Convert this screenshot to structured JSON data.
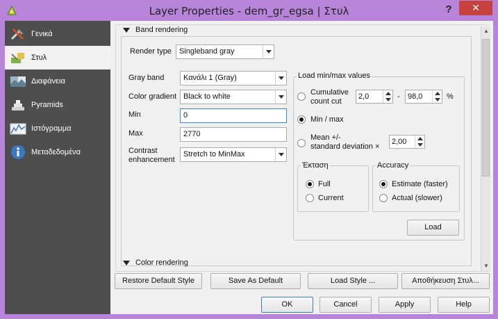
{
  "window": {
    "title": "Layer Properties - dem_gr_egsa | Στυλ",
    "help": "?",
    "close": "✕"
  },
  "sidebar": {
    "items": [
      {
        "label": "Γενικά",
        "icon": "tools-icon"
      },
      {
        "label": "Στυλ",
        "icon": "style-icon"
      },
      {
        "label": "Διαφάνεια",
        "icon": "transparency-icon"
      },
      {
        "label": "Pyramids",
        "icon": "pyramids-icon"
      },
      {
        "label": "Ιστόγραμμα",
        "icon": "histogram-icon"
      },
      {
        "label": "Μεταδεδομένα",
        "icon": "info-icon"
      }
    ]
  },
  "band_rendering": {
    "header": "Band rendering",
    "render_type_label": "Render type",
    "render_type_value": "Singleband gray",
    "gray_band_label": "Gray band",
    "gray_band_value": "Κανάλι 1 (Gray)",
    "color_gradient_label": "Color gradient",
    "color_gradient_value": "Black to white",
    "min_label": "Min",
    "min_value": "0",
    "max_label": "Max",
    "max_value": "2770",
    "contrast_label_1": "Contrast",
    "contrast_label_2": "enhancement",
    "contrast_value": "Stretch to MinMax"
  },
  "load_minmax": {
    "title": "Load min/max values",
    "cumulative_label_1": "Cumulative",
    "cumulative_label_2": "count cut",
    "cumulative_low": "2,0",
    "dash": "-",
    "cumulative_high": "98,0",
    "percent": "%",
    "minmax_label": "Min / max",
    "mean_label_1": "Mean +/-",
    "mean_label_2": "standard deviation ×",
    "mean_value": "2,00",
    "extent_title": "Έκταση",
    "extent_full": "Full",
    "extent_current": "Current",
    "accuracy_title": "Accuracy",
    "accuracy_estimate": "Estimate (faster)",
    "accuracy_actual": "Actual (slower)",
    "load_button": "Load"
  },
  "color_rendering": {
    "header": "Color rendering"
  },
  "style_buttons": {
    "restore": "Restore Default Style",
    "save_default": "Save As Default",
    "load_style": "Load Style ...",
    "save_style": "Αποθήκευση Στυλ..."
  },
  "dialog_buttons": {
    "ok": "OK",
    "cancel": "Cancel",
    "apply": "Apply",
    "help": "Help"
  },
  "colors": {
    "titlebar": "#b784d9",
    "sidebar": "#4e4e4e",
    "close": "#c7413d",
    "focus": "#3d86d6"
  }
}
